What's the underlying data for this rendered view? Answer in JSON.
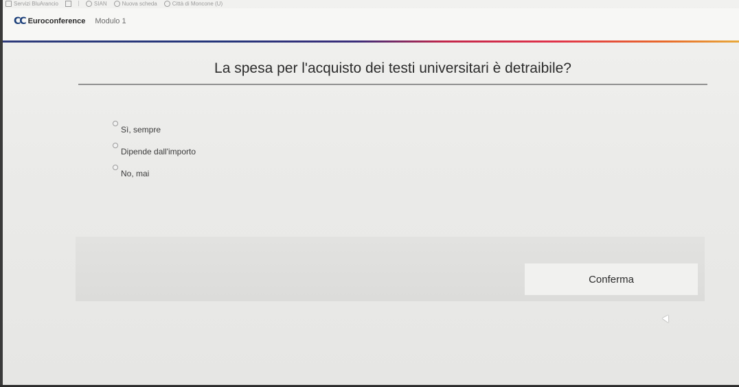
{
  "bookmarks": [
    {
      "label": "Servizi BluArancio",
      "icon": "folder-icon"
    },
    {
      "label": "",
      "icon": "grid-icon"
    },
    {
      "label": "SIAN",
      "icon": "globe-icon"
    },
    {
      "label": "Nuova scheda",
      "icon": "globe-icon"
    },
    {
      "label": "Città di Moncone (U)",
      "icon": "globe-icon"
    }
  ],
  "header": {
    "logo": "CC",
    "brand": "Euroconference",
    "module": "Modulo 1"
  },
  "quiz": {
    "question": "La spesa per l'acquisto dei testi universitari è detraibile?",
    "options": [
      {
        "label": "Sì, sempre"
      },
      {
        "label": "Dipende dall'importo"
      },
      {
        "label": "No, mai"
      }
    ],
    "confirm_label": "Conferma"
  },
  "colors": {
    "brand_blue": "#1c3f7a",
    "accent_red": "#c2264a",
    "accent_orange": "#e8a83a"
  }
}
